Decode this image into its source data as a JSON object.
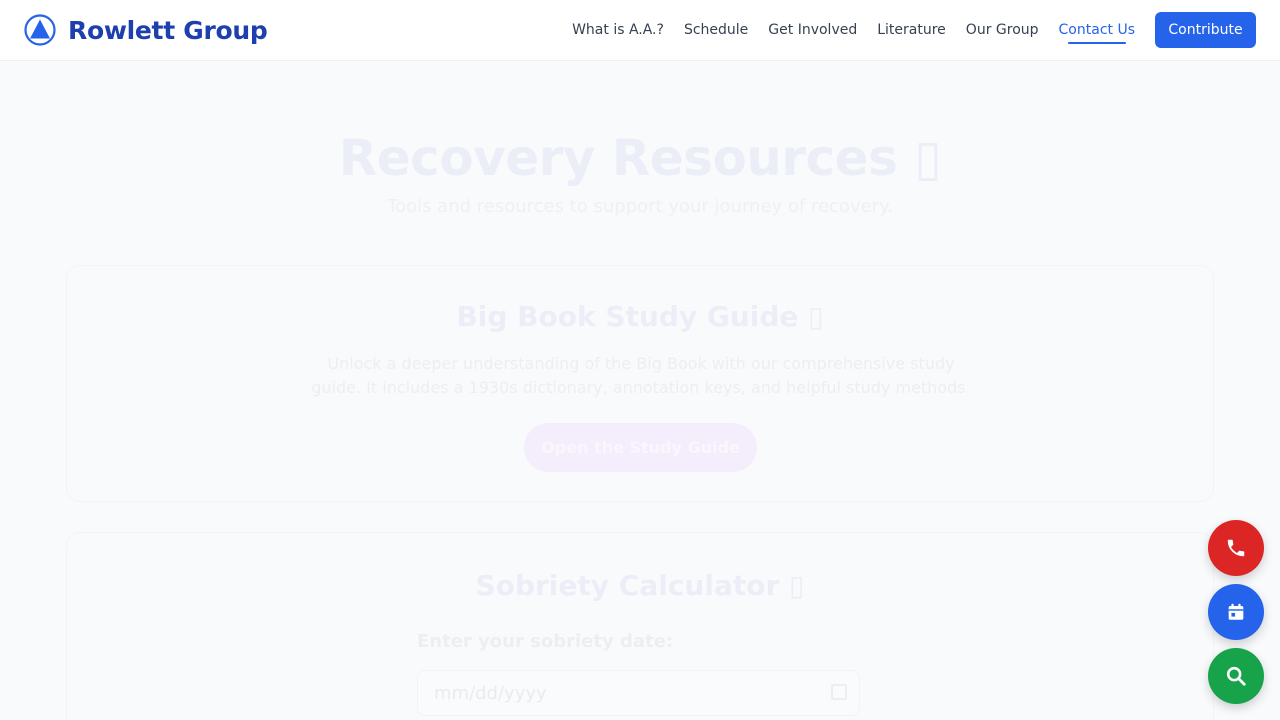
{
  "brand": {
    "name": "Rowlett Group",
    "icon": "triangle-circle-logo-icon",
    "color": "#1e40af"
  },
  "nav": {
    "items": [
      {
        "label": "What is A.A.?"
      },
      {
        "label": "Schedule"
      },
      {
        "label": "Get Involved"
      },
      {
        "label": "Literature"
      },
      {
        "label": "Our Group"
      },
      {
        "label": "Contact Us",
        "active": true
      }
    ],
    "cta": "Contribute",
    "accent": "#2563eb"
  },
  "hero": {
    "title": "Recovery Resources ▯",
    "subtitle": "Tools and resources to support your journey of recovery."
  },
  "study_guide": {
    "title": "Big Book Study Guide ▯",
    "description": "Unlock a deeper understanding of the Big Book with our comprehensive study guide. It includes a 1930s dictionary, annotation keys, and helpful study methods.",
    "button": "Open the Study Guide"
  },
  "sobriety_calculator": {
    "title": "Sobriety Calculator ▯",
    "date_label": "Enter your sobriety date:",
    "date_placeholder": "mm/dd/yyyy"
  },
  "floating_actions": [
    {
      "icon": "phone-icon",
      "color": "#dc2626"
    },
    {
      "icon": "calendar-icon",
      "color": "#2563eb"
    },
    {
      "icon": "search-icon",
      "color": "#16a34a"
    }
  ]
}
